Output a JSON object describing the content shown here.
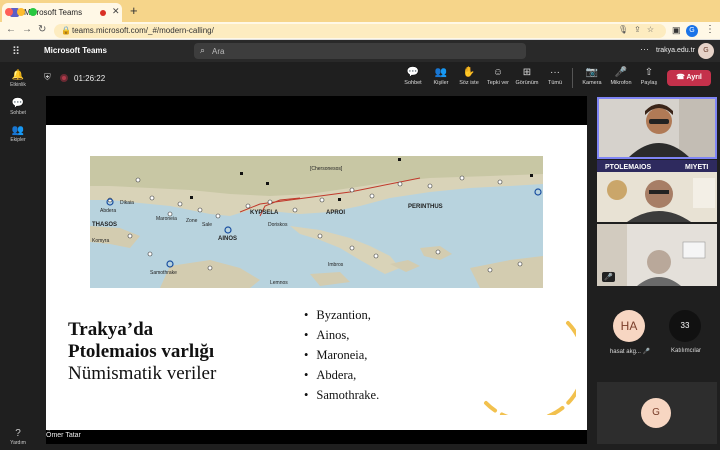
{
  "browser": {
    "tab_title": "Microsoft Teams",
    "url": "teams.microsoft.com/_#/modern-calling/",
    "profile_initial": "G",
    "colors": {
      "chrome": "#f6d58a",
      "toolbar": "#fff8e6"
    }
  },
  "teams": {
    "app_name": "Microsoft Teams",
    "search_placeholder": "Ara",
    "org": "trakya.edu.tr",
    "user_initial": "G"
  },
  "rail": {
    "items": [
      {
        "label": "Etkinlik",
        "icon": "bell-icon"
      },
      {
        "label": "Sohbet",
        "icon": "chat-icon"
      },
      {
        "label": "Ekipler",
        "icon": "teams-icon"
      },
      {
        "label": "Yardım",
        "icon": "help-icon"
      }
    ]
  },
  "meeting": {
    "timer": "01:26:22",
    "controls": [
      {
        "label": "Sohbet",
        "icon": "chat-icon"
      },
      {
        "label": "Kişiler",
        "icon": "people-icon"
      },
      {
        "label": "Söz iste",
        "icon": "raise-hand-icon"
      },
      {
        "label": "Tepki ver",
        "icon": "reaction-icon"
      },
      {
        "label": "Görünüm",
        "icon": "layout-icon"
      },
      {
        "label": "Tümü",
        "icon": "more-icon"
      },
      {
        "label": "Kamera",
        "icon": "camera-off-icon"
      },
      {
        "label": "Mikrofon",
        "icon": "mic-off-icon"
      },
      {
        "label": "Paylaş",
        "icon": "share-icon"
      }
    ],
    "leave_label": "Ayrıl",
    "leave_color": "#c4314b"
  },
  "slide": {
    "heading_line1": "Trakya’da",
    "heading_line2": "Ptolemaios varlığı",
    "heading_line3": "Nümismatik veriler",
    "bullets": [
      "Byzantion,",
      "Ainos,",
      "Maroneia,",
      "Abdera,",
      "Samothrake."
    ],
    "map_labels": [
      "[Chersonesos]",
      "KYPSELA",
      "APROI",
      "PERINTHUS",
      "AINOS",
      "THASOS",
      "Maroneia",
      "Abdera",
      "Zone",
      "Sale",
      "Doriskos",
      "Samothrake",
      "Imbros",
      "Lemnos",
      "Komyra",
      "Dikaia"
    ],
    "accent_color": "#f2c14e"
  },
  "speaker_name": "Ömer Tatar",
  "participants": {
    "tile_banner": "PTOLEMAIOS",
    "tile_banner2": "MIYETI",
    "hasat_initials": "HA",
    "hasat_name": "hasat akg...",
    "count": "33",
    "count_label": "Katılımcılar",
    "g_initial": "G"
  }
}
